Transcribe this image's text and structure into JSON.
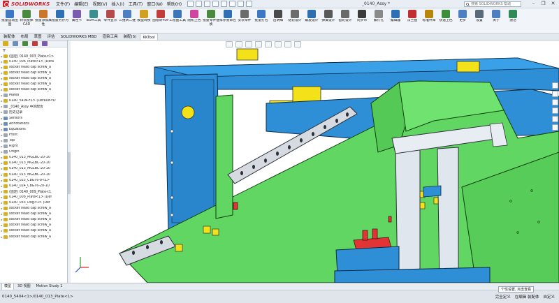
{
  "app": {
    "brand": "SOLIDWORKS",
    "document_title": "_0140_Assy *",
    "search_placeholder": "搜索 SOLIDWORKS 帮助"
  },
  "menu": [
    "文件(F)",
    "编辑(E)",
    "视图(V)",
    "插入(I)",
    "工具(T)",
    "窗口(W)",
    "帮助(H)"
  ],
  "window_controls": [
    "–",
    "❐",
    "✕"
  ],
  "ribbon": [
    {
      "label": "批量自动出图",
      "color": "#3d78c6"
    },
    {
      "label": "转装配体CAD",
      "color": "#4a8a3f"
    },
    {
      "label": "批量添加属性",
      "color": "#c9782b"
    },
    {
      "label": "批量另存为",
      "color": "#2f6fb3"
    },
    {
      "label": "属性卡",
      "color": "#7a5bb0"
    },
    {
      "label": "BOM工具",
      "color": "#3b8f8c"
    },
    {
      "label": "零件显示",
      "color": "#b54a4a"
    },
    {
      "label": "三维转二维",
      "color": "#4e7fc0"
    },
    {
      "label": "模型转换",
      "color": "#d0a020"
    },
    {
      "label": "图纸转PDF",
      "color": "#c23c3c"
    },
    {
      "label": "工程图工具",
      "color": "#3c76b8"
    },
    {
      "label": "随机上色",
      "color": "#d045a0"
    },
    {
      "label": "批量零件替换",
      "color": "#4a8a3f"
    },
    {
      "label": "排序重命名",
      "color": "#2f6fb3"
    },
    {
      "label": "安装零件",
      "color": "#6b6b6b"
    },
    {
      "label": "批量打包",
      "color": "#3d78c6"
    },
    {
      "label": "出明细",
      "color": "#4a4a4a"
    },
    {
      "label": "链轮设计",
      "color": "#6c6c6c"
    },
    {
      "label": "螺旋设计",
      "color": "#2e6fb0"
    },
    {
      "label": "弹簧设计",
      "color": "#5a5a5a"
    },
    {
      "label": "齿轮设计",
      "color": "#6a6a6a"
    },
    {
      "label": "同步带",
      "color": "#3a3a3a"
    },
    {
      "label": "螺钉孔",
      "color": "#8a8a8a"
    },
    {
      "label": "编辑器",
      "color": "#2f6fb3"
    },
    {
      "label": "法兰盘",
      "color": "#c03030"
    },
    {
      "label": "标准件库",
      "color": "#b8860b"
    },
    {
      "label": "快速上色",
      "color": "#3b8f3b"
    },
    {
      "label": "更多",
      "color": "#4e7fc0"
    },
    {
      "label": "设置",
      "color": "#5a6a7a"
    },
    {
      "label": "关于",
      "color": "#4e7fc0"
    },
    {
      "label": "激活",
      "color": "#2e8b57"
    }
  ],
  "command_tabs": [
    "装配体",
    "布局",
    "草图",
    "评估",
    "SOLIDWORKS MBD",
    "渲染工具",
    "装配(S)",
    "KKTool"
  ],
  "command_tab_active": 7,
  "tree": [
    {
      "text": "(固定) 0140_003_Plate<1>",
      "icon": "#d6b020"
    },
    {
      "text": "0140_006_Plate<1> (Defa",
      "icon": "#d6b020"
    },
    {
      "text": "socket head cap screw_a",
      "icon": "#d6b020"
    },
    {
      "text": "socket head cap screw_a",
      "icon": "#d6b020"
    },
    {
      "text": "socket head cap screw_a",
      "icon": "#d6b020"
    },
    {
      "text": "socket head cap screw_a",
      "icon": "#d6b020"
    },
    {
      "text": "socket head cap screw_a",
      "icon": "#d6b020"
    },
    {
      "text": "Mates",
      "icon": "#9aa6b2"
    },
    {
      "text": "0140_5404<1> (Default<D",
      "icon": "#d6b020"
    },
    {
      "text": "_0140_Assy 中的配合",
      "icon": "#9aa6b2"
    },
    {
      "text": "历史记录",
      "icon": "#9aa6b2"
    },
    {
      "text": "Sensors",
      "icon": "#6a8fb8"
    },
    {
      "text": "Annotations",
      "icon": "#6a8fb8"
    },
    {
      "text": "Equations",
      "icon": "#6a8fb8"
    },
    {
      "text": "Front",
      "icon": "#9aa6b2"
    },
    {
      "text": "Top",
      "icon": "#9aa6b2"
    },
    {
      "text": "Right",
      "icon": "#9aa6b2"
    },
    {
      "text": "Origin",
      "icon": "#9aa6b2"
    },
    {
      "text": "0140_013_MGLBC-20-10",
      "icon": "#d6b020"
    },
    {
      "text": "0140_013_MGLBC-20-10",
      "icon": "#d6b020"
    },
    {
      "text": "0140_013_MGLBC-20-10",
      "icon": "#d6b020"
    },
    {
      "text": "0140_013_MGLBC-20-10",
      "icon": "#d6b020"
    },
    {
      "text": "0140_025_CBGT6-8<1>",
      "icon": "#d6b020"
    },
    {
      "text": "0140_024_CBGT6-20-10",
      "icon": "#d6b020"
    },
    {
      "text": "(固定) 0140_009_Plate<1",
      "icon": "#d6b020"
    },
    {
      "text": "0140_008_Plate<1> (Def",
      "icon": "#d6b020"
    },
    {
      "text": "0140_033_Dog<1> (Def",
      "icon": "#d6b020"
    },
    {
      "text": "socket head cap screw_a",
      "icon": "#d6b020"
    },
    {
      "text": "socket head cap screw_a",
      "icon": "#d6b020"
    },
    {
      "text": "socket head cap screw_a",
      "icon": "#d6b020"
    },
    {
      "text": "socket head cap screw_a",
      "icon": "#d6b020"
    },
    {
      "text": "socket head cap screw_a",
      "icon": "#d6b020"
    },
    {
      "text": "socket head cap screw_a",
      "icon": "#d6b020"
    }
  ],
  "bottom_tabs": [
    "模型",
    "3D 视图",
    "Motion Study 1"
  ],
  "bottom_tab_active": 0,
  "status": {
    "left": "0140_5404<1>/0140_013_Plate<1>",
    "right": [
      "完全定义",
      "在编辑 装配体",
      "自定义"
    ]
  },
  "toast": "个性设置, 点击查看",
  "colors": {
    "part_blue": "#2f8fd6",
    "part_green": "#62d662",
    "part_yellow": "#f3e21a",
    "part_red": "#e23434",
    "rail_gray": "#d6dbe2"
  }
}
